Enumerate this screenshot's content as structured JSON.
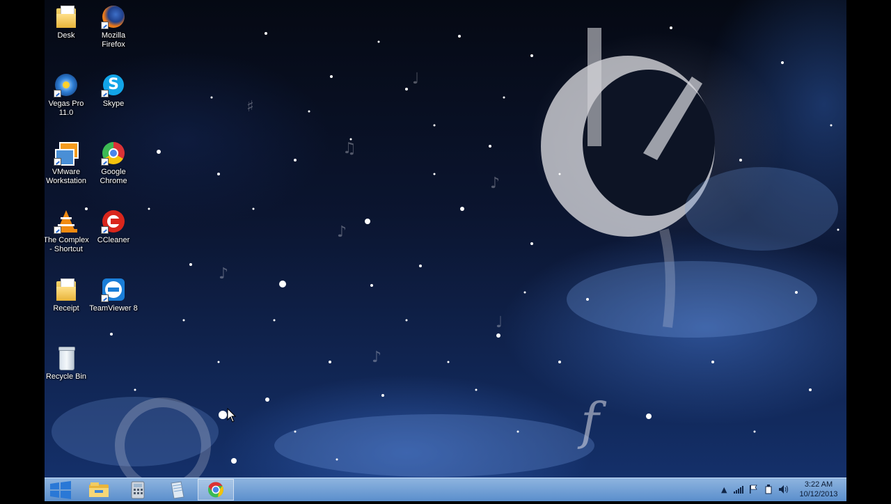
{
  "desktop_icons": [
    {
      "label": "Desk",
      "icon": "folder-icon"
    },
    {
      "label": "Mozilla Firefox",
      "icon": "firefox-icon"
    },
    {
      "label": "Vegas Pro 11.0",
      "icon": "vegas-pro-icon"
    },
    {
      "label": "Skype",
      "icon": "skype-icon"
    },
    {
      "label": "VMware Workstation",
      "icon": "vmware-icon"
    },
    {
      "label": "Google Chrome",
      "icon": "chrome-icon"
    },
    {
      "label": "The Complex - Shortcut",
      "icon": "vlc-icon"
    },
    {
      "label": "CCleaner",
      "icon": "ccleaner-icon"
    },
    {
      "label": "Receipt",
      "icon": "folder-icon"
    },
    {
      "label": "TeamViewer 8",
      "icon": "teamviewer-icon"
    },
    {
      "label": "Recycle Bin",
      "icon": "recycle-bin-icon"
    }
  ],
  "taskbar": {
    "start": "windows-logo-icon",
    "pinned": [
      "file-explorer-icon",
      "calculator-icon",
      "notepad-icon",
      "chrome-icon"
    ],
    "active": "chrome-icon"
  },
  "tray": {
    "icons": [
      "show-hidden-icons-icon",
      "network-signal-icon",
      "action-center-flag-icon",
      "power-icon",
      "volume-icon"
    ],
    "time": "3:22 AM",
    "date": "10/12/2013"
  },
  "colors": {
    "taskbar": "#6aa0da",
    "sky": "#0b1530"
  }
}
